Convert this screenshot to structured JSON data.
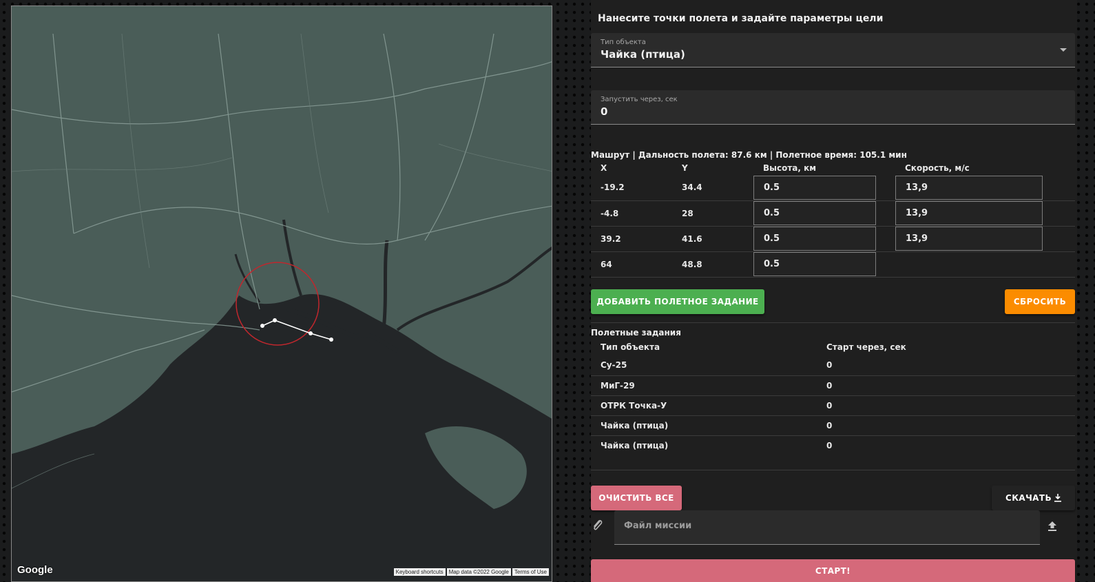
{
  "map": {
    "google_logo": "Google",
    "attribution": [
      "Keyboard shortcuts",
      "Map data ©2022 Google",
      "Terms of Use"
    ]
  },
  "panel": {
    "heading": "Нанесите точки полета и задайте параметры цели",
    "object_type": {
      "label": "Тип объекта",
      "value": "Чайка (птица)"
    },
    "launch_delay": {
      "label": "Запустить через, сек",
      "value": "0"
    },
    "route_summary": "Машрут | Дальность полета: 87.6 км | Полетное время: 105.1 мин",
    "route_headers": {
      "x": "X",
      "y": "Y",
      "altitude": "Высота, км",
      "speed": "Скорость, м/с"
    },
    "route_rows": [
      {
        "x": "-19.2",
        "y": "34.4",
        "altitude": "0.5",
        "speed": "13,9"
      },
      {
        "x": "-4.8",
        "y": "28",
        "altitude": "0.5",
        "speed": "13,9"
      },
      {
        "x": "39.2",
        "y": "41.6",
        "altitude": "0.5",
        "speed": "13,9"
      },
      {
        "x": "64",
        "y": "48.8",
        "altitude": "0.5"
      }
    ],
    "add_task_label": "ДОБАВИТЬ ПОЛЕТНОЕ ЗАДАНИЕ",
    "reset_label": "СБРОСИТЬ",
    "tasks_title": "Полетные задания",
    "tasks_headers": {
      "type": "Тип объекта",
      "start": "Старт через, сек"
    },
    "tasks": [
      {
        "type": "Су-25",
        "start": "0"
      },
      {
        "type": "МиГ-29",
        "start": "0"
      },
      {
        "type": "ОТРК Точка-У",
        "start": "0"
      },
      {
        "type": "Чайка (птица)",
        "start": "0"
      },
      {
        "type": "Чайка (птица)",
        "start": "0"
      }
    ],
    "clear_all_label": "ОЧИСТИТЬ ВСЕ",
    "download_label": "СКАЧАТЬ",
    "mission_file_placeholder": "Файл миссии",
    "start_label": "СТАРТ!",
    "colors": {
      "green": "#4caf50",
      "orange": "#fb8c00",
      "pink": "#d5697a",
      "panel": "#1f1f1f"
    }
  }
}
